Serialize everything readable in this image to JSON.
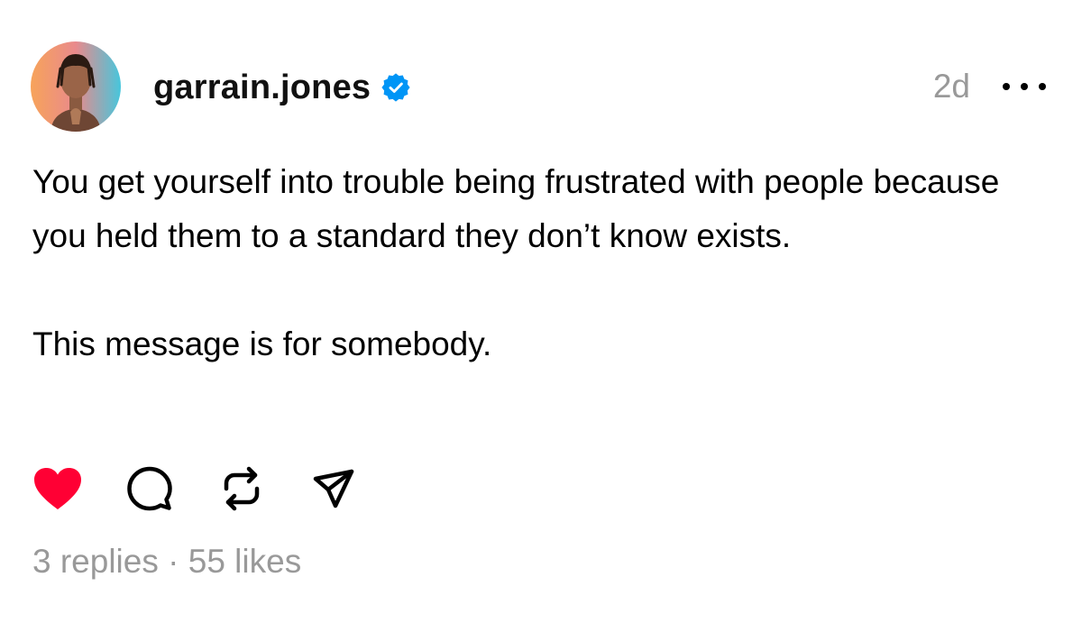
{
  "post": {
    "author": {
      "username": "garrain.jones",
      "verified": true,
      "avatar": "avatar-photo"
    },
    "timestamp": "2d",
    "more_icon": "more-horizontal-icon",
    "text": {
      "paragraph1": "You get yourself into trouble being frustrated with people because you held them to a standard they don’t know exists.",
      "paragraph2": "This message is for somebody."
    },
    "actions": [
      {
        "icon": "heart-icon",
        "state": "liked",
        "color": "#FF0034"
      },
      {
        "icon": "comment-icon"
      },
      {
        "icon": "repost-icon"
      },
      {
        "icon": "share-icon"
      }
    ],
    "stats": {
      "replies": "3 replies",
      "separator": "·",
      "likes": "55 likes"
    }
  },
  "colors": {
    "text": "#000000",
    "muted": "#999999",
    "verified_badge": "#0095F6",
    "like_active": "#FF0034"
  }
}
